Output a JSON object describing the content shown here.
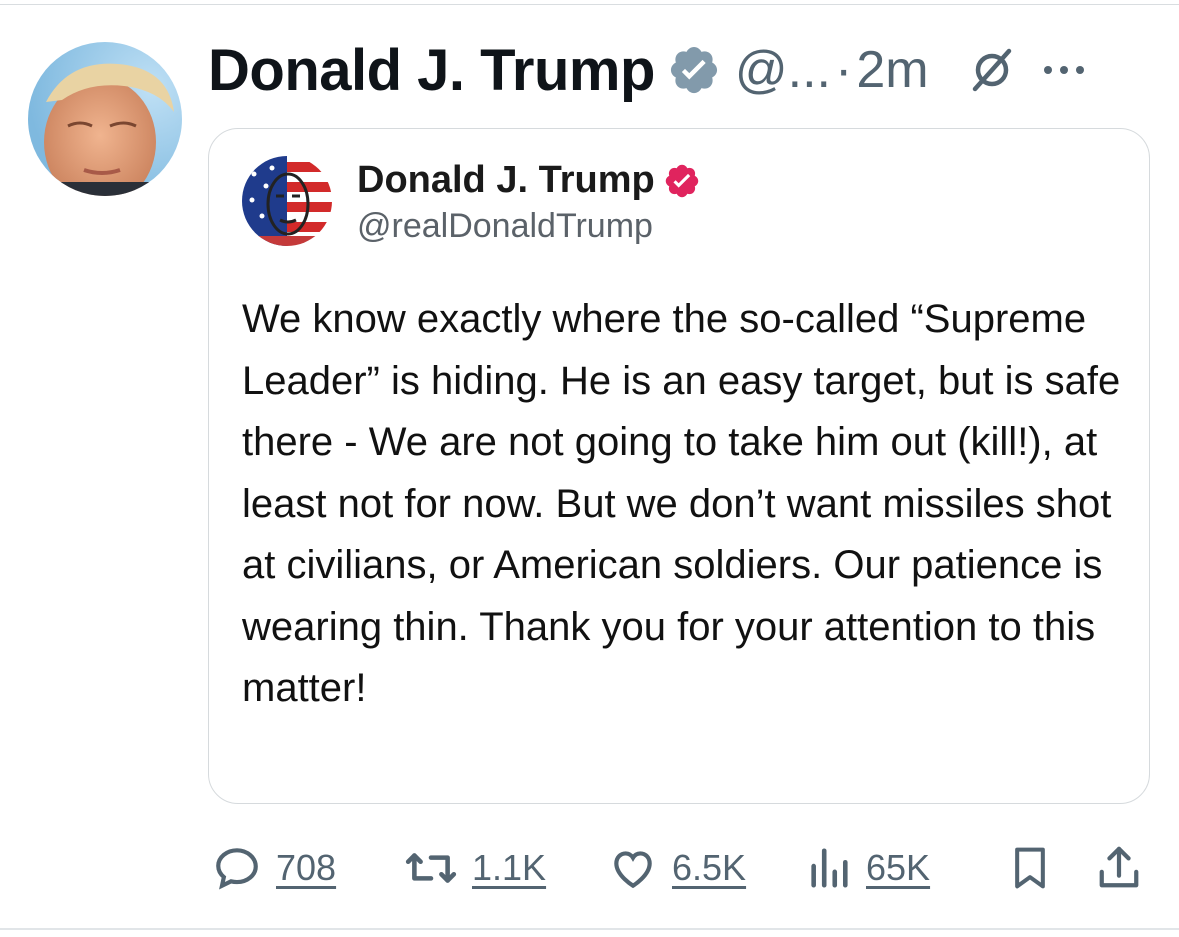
{
  "post": {
    "author_name": "Donald J. Trump",
    "handle_truncated": "@...",
    "separator": "·",
    "time": "2m",
    "avatar_icon": "profile-photo",
    "verified_icon": "verified-badge-gray",
    "grok_icon": "grok-icon",
    "more_icon": "more-horizontal-icon"
  },
  "quote": {
    "author_name": "Donald J. Trump",
    "handle": "@realDonaldTrump",
    "verified_icon": "verified-badge-red",
    "verified_color": "#e0245e",
    "text": "We know exactly where the so-called “Supreme Leader” is hiding. He is an easy target, but is safe there - We are not going to take him out (kill!), at least not for now. But we don’t want missiles shot at civilians, or American soldiers. Our patience is wearing thin. Thank you for your attention to this matter!"
  },
  "actions": {
    "replies": "708",
    "reposts": "1.1K",
    "likes": "6.5K",
    "views": "65K",
    "icons": [
      "reply-icon",
      "repost-icon",
      "like-icon",
      "views-icon",
      "bookmark-icon",
      "share-icon"
    ]
  },
  "colors": {
    "text_primary": "#0f1419",
    "text_secondary": "#536471",
    "verified_gray": "#829aab",
    "border": "#d6dadd"
  }
}
